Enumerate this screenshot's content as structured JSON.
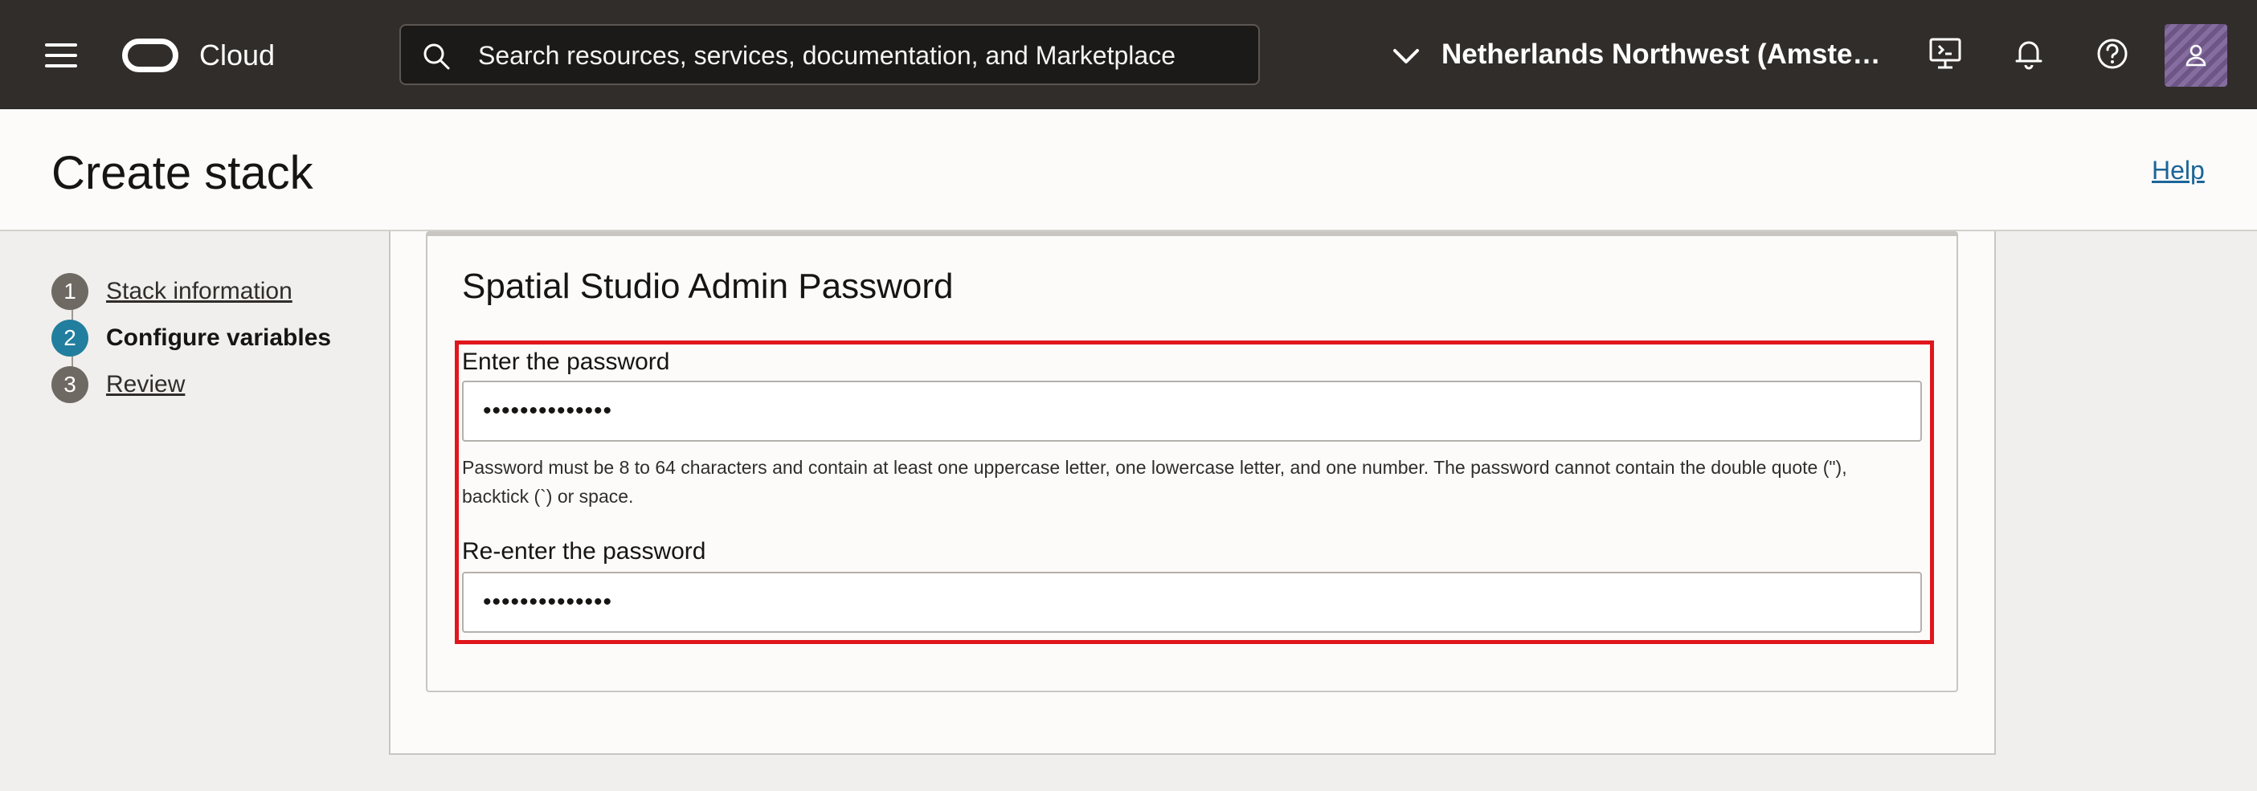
{
  "header": {
    "brand": "Cloud",
    "search_placeholder": "Search resources, services, documentation, and Marketplace",
    "region": "Netherlands Northwest (Amste…",
    "icons": [
      "menu-icon",
      "oracle-logo-icon",
      "search-icon",
      "chevron-down-icon",
      "cloud-shell-icon",
      "bell-icon",
      "help-icon",
      "user-icon"
    ]
  },
  "page": {
    "title": "Create stack",
    "help_link": "Help"
  },
  "steps": [
    {
      "number": "1",
      "label": "Stack information",
      "state": "complete"
    },
    {
      "number": "2",
      "label": "Configure variables",
      "state": "current"
    },
    {
      "number": "3",
      "label": "Review",
      "state": "upcoming"
    }
  ],
  "section": {
    "title": "Spatial Studio Admin Password",
    "password_label": "Enter the password",
    "password_value": "••••••••••••••",
    "hint": "Password must be 8 to 64 characters and contain at least one uppercase letter, one lowercase letter, and one number. The password cannot contain the double quote (\"), backtick (`) or space.",
    "confirm_label": "Re-enter the password",
    "confirm_value": "••••••••••••••"
  },
  "colors": {
    "header_bg": "#312d2a",
    "active_step": "#227e9e",
    "highlight_border": "#e0161c",
    "link": "#1b6598"
  }
}
